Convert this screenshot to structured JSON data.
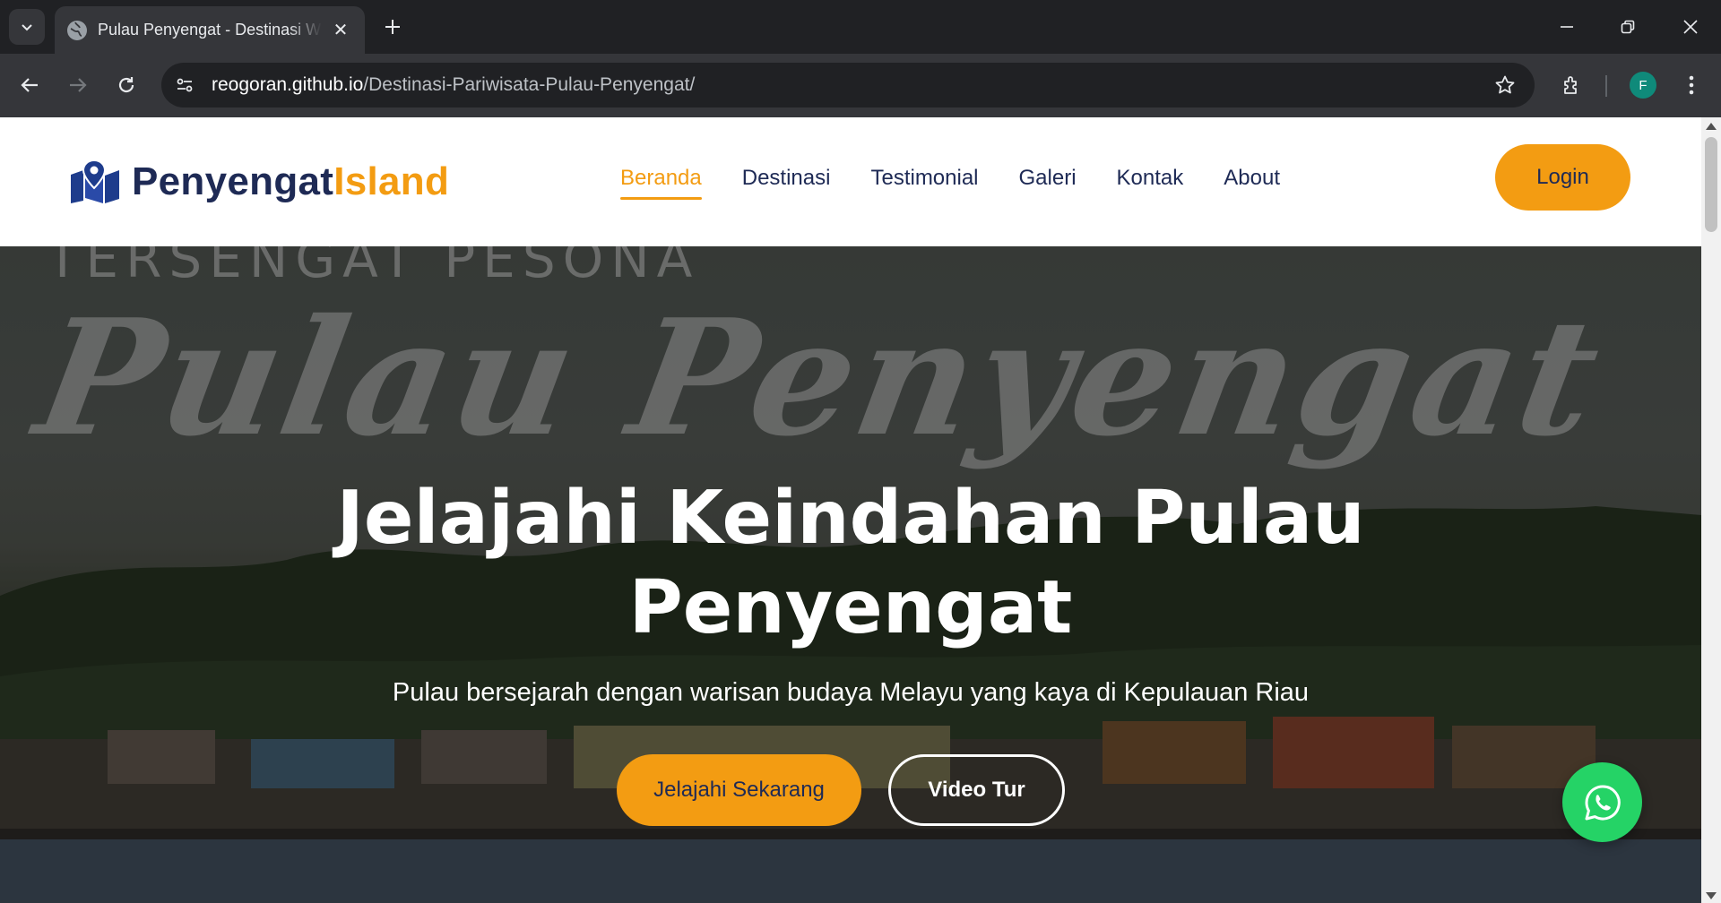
{
  "browser": {
    "tab_title": "Pulau Penyengat - Destinasi Wisata",
    "url_host": "reogoran.github.io",
    "url_path": "/Destinasi-Pariwisata-Pulau-Penyengat/",
    "profile_initial": "F",
    "icons": [
      "tab-search-icon",
      "globe-icon",
      "close-icon",
      "plus-icon",
      "minimize-icon",
      "restore-icon",
      "close-window-icon",
      "back-icon",
      "forward-icon",
      "reload-icon",
      "site-info-icon",
      "star-icon",
      "extensions-icon",
      "menu-dots-icon"
    ]
  },
  "header": {
    "logo_part1": "Penyengat",
    "logo_part2": "Island",
    "menu": [
      {
        "label": "Beranda",
        "active": true
      },
      {
        "label": "Destinasi",
        "active": false
      },
      {
        "label": "Testimonial",
        "active": false
      },
      {
        "label": "Galeri",
        "active": false
      },
      {
        "label": "Kontak",
        "active": false
      },
      {
        "label": "About",
        "active": false
      }
    ],
    "login_label": "Login"
  },
  "hero": {
    "watermark_top": "TERSENGAT PESONA",
    "watermark_script": "Pulau Penyengat",
    "title_line1": "Jelajahi Keindahan Pulau",
    "title_line2": "Penyengat",
    "subtitle": "Pulau bersejarah dengan warisan budaya Melayu yang kaya di Kepulauan Riau",
    "btn_primary": "Jelajahi Sekarang",
    "btn_secondary": "Video Tur"
  },
  "colors": {
    "accent": "#f39c12",
    "navy": "#1e2a55",
    "whatsapp": "#25d366"
  }
}
